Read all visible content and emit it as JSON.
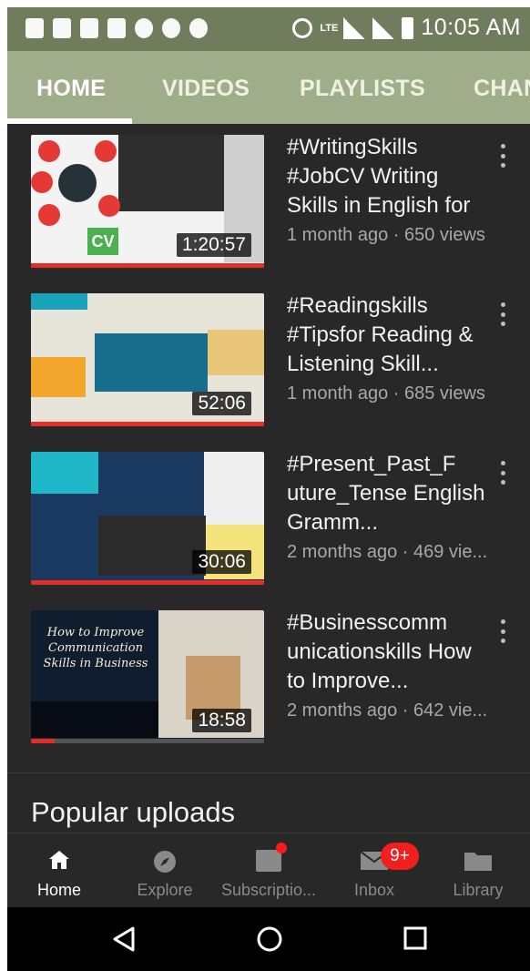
{
  "status_bar": {
    "time": "10:05 AM",
    "network": "LTE"
  },
  "tabs": [
    {
      "label": "HOME",
      "active": true
    },
    {
      "label": "VIDEOS",
      "active": false
    },
    {
      "label": "PLAYLISTS",
      "active": false
    },
    {
      "label": "CHAN",
      "active": false
    }
  ],
  "videos": [
    {
      "title": "#WritingSkills #JobCV  Writing Skills in English for Job Application...",
      "meta": "1 month ago · 650 views",
      "duration": "1:20:57",
      "watched": 1.0
    },
    {
      "title": "#Readingskills #Tipsfor Reading & Listening Skill...",
      "meta": "1 month ago · 685 views",
      "duration": "52:06",
      "watched": 1.0
    },
    {
      "title": "#Present_Past_F uture_Tense English Gramm...",
      "meta": "2 months ago · 469 vie...",
      "duration": "30:06",
      "watched": 1.0
    },
    {
      "title": "#Businesscomm unicationskills How to Improve...",
      "meta": "2 months ago · 642 vie...",
      "duration": "18:58",
      "watched": 0.1
    }
  ],
  "thumb4_text": "How to Improve Communication Skills in Business",
  "thumb1_badge": "CV",
  "section_title": "Popular uploads",
  "bottom_nav": [
    {
      "label": "Home",
      "icon": "home-icon",
      "active": true
    },
    {
      "label": "Explore",
      "icon": "compass-icon",
      "active": false
    },
    {
      "label": "Subscriptio...",
      "icon": "subscriptions-icon",
      "active": false
    },
    {
      "label": "Inbox",
      "icon": "inbox-icon",
      "active": false,
      "badge": "9+"
    },
    {
      "label": "Library",
      "icon": "library-folder-icon",
      "active": false
    }
  ],
  "colors": {
    "status_bar": "#6f7d5c",
    "tab_bar": "#a0ad8a",
    "background": "#282828",
    "progress": "#e52d27",
    "badge": "#f21f1f"
  }
}
